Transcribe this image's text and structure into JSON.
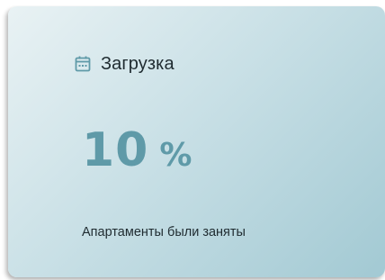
{
  "card": {
    "icon": "calendar-icon",
    "title": "Загрузка",
    "value": "10",
    "unit": "%",
    "caption": "Апартаменты были заняты"
  },
  "colors": {
    "accent": "#5f9aa8",
    "text": "#1f2b30",
    "gradient_start": "#e9f2f4",
    "gradient_end": "#a2c9d3"
  }
}
